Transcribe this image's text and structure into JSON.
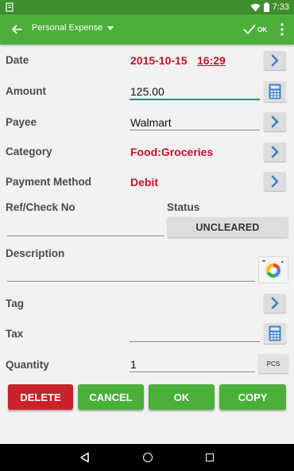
{
  "status_bar": {
    "time": "7:33"
  },
  "toolbar": {
    "title": "Personal Expense",
    "ok_label": "OK"
  },
  "form": {
    "date": {
      "label": "Date",
      "date": "2015-10-15",
      "time": "16:29"
    },
    "amount": {
      "label": "Amount",
      "value": "125.00"
    },
    "payee": {
      "label": "Payee",
      "value": "Walmart"
    },
    "category": {
      "label": "Category",
      "value": "Food:Groceries"
    },
    "payment_method": {
      "label": "Payment Method",
      "value": "Debit"
    },
    "ref_check": {
      "label": "Ref/Check No",
      "value": ""
    },
    "status": {
      "label": "Status",
      "value": "UNCLEARED"
    },
    "description": {
      "label": "Description",
      "value": ""
    },
    "tag": {
      "label": "Tag",
      "value": ""
    },
    "tax": {
      "label": "Tax",
      "value": ""
    },
    "quantity": {
      "label": "Quantity",
      "value": "1",
      "unit": "PCS"
    }
  },
  "actions": {
    "delete": "DELETE",
    "cancel": "CANCEL",
    "ok": "OK",
    "copy": "COPY"
  },
  "colors": {
    "primary": "#4caf3a",
    "status_bar": "#3e8e2b",
    "accent_red": "#c8102e",
    "delete_button": "#c8232b",
    "green_button": "#4caf3a",
    "chevron_blue": "#3d7fc8"
  },
  "icons": {
    "back": "arrow-left-icon",
    "ok": "check-icon",
    "menu": "more-vert-icon",
    "chevron": "chevron-right-icon",
    "calculator": "calculator-icon",
    "camera": "camera-icon",
    "wifi": "wifi-icon",
    "battery": "battery-icon"
  }
}
